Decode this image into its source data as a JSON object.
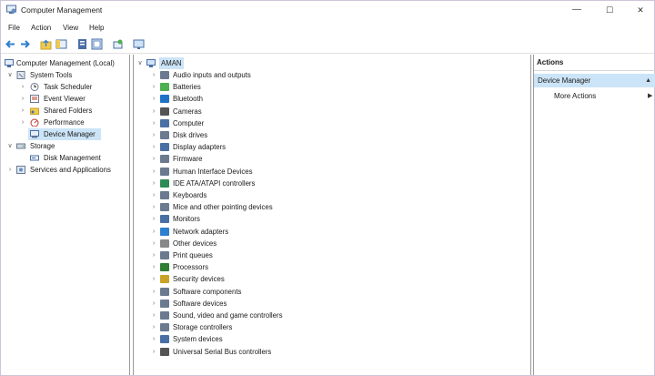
{
  "window": {
    "title": "Computer Management",
    "minimize": "—",
    "maximize": "☐",
    "close": "✕"
  },
  "menu": [
    "File",
    "Action",
    "View",
    "Help"
  ],
  "toolbar": [
    "back-arrow-icon",
    "forward-arrow-icon",
    "up-folder-icon",
    "show-hide-tree-icon",
    "properties-icon",
    "help-icon",
    "export-icon",
    "console-icon"
  ],
  "tree": [
    {
      "label": "Computer Management (Local)",
      "icon": "computer-management-icon",
      "chev": "",
      "level": 0
    },
    {
      "label": "System Tools",
      "icon": "system-tools-icon",
      "chev": "∨",
      "level": 1
    },
    {
      "label": "Task Scheduler",
      "icon": "clock-icon",
      "chev": "›",
      "level": 2
    },
    {
      "label": "Event Viewer",
      "icon": "event-viewer-icon",
      "chev": "›",
      "level": 2
    },
    {
      "label": "Shared Folders",
      "icon": "shared-folder-icon",
      "chev": "›",
      "level": 2
    },
    {
      "label": "Performance",
      "icon": "performance-icon",
      "chev": "›",
      "level": 2
    },
    {
      "label": "Device Manager",
      "icon": "device-manager-icon",
      "chev": "",
      "level": 2,
      "selected": true
    },
    {
      "label": "Storage",
      "icon": "storage-icon",
      "chev": "∨",
      "level": 1
    },
    {
      "label": "Disk Management",
      "icon": "disk-management-icon",
      "chev": "",
      "level": 2
    },
    {
      "label": "Services and Applications",
      "icon": "services-icon",
      "chev": "›",
      "level": 1
    }
  ],
  "devices": {
    "root": "AMAN",
    "items": [
      "Audio inputs and outputs",
      "Batteries",
      "Bluetooth",
      "Cameras",
      "Computer",
      "Disk drives",
      "Display adapters",
      "Firmware",
      "Human Interface Devices",
      "IDE ATA/ATAPI controllers",
      "Keyboards",
      "Mice and other pointing devices",
      "Monitors",
      "Network adapters",
      "Other devices",
      "Print queues",
      "Processors",
      "Security devices",
      "Software components",
      "Software devices",
      "Sound, video and game controllers",
      "Storage controllers",
      "System devices",
      "Universal Serial Bus controllers"
    ]
  },
  "actions": {
    "title": "Actions",
    "header": "Device Manager",
    "header_arrow": "▲",
    "more": "More Actions",
    "more_arrow": "▶"
  }
}
